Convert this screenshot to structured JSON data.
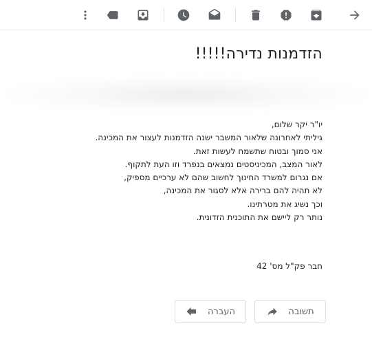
{
  "toolbar": {
    "icons": [
      "back-arrow-icon",
      "archive-icon",
      "report-spam-icon",
      "delete-icon",
      "mark-unread-icon",
      "snooze-icon",
      "move-to-inbox-icon",
      "label-icon",
      "more-vert-icon"
    ]
  },
  "email": {
    "subject": "הזדמנות נדירה!!!!!",
    "body": [
      "יו\"ר יקר שלום,",
      "גיליתי לאחרונה שלאור המשבר ישנה הזדמנות לעצור את המכינה.",
      "אני סמוך ובטוח שתשמח לעשות זאת.",
      "לאור המצב, המכיניסטים נמצאים בנפרד וזו העת לתקוף.",
      "אם נגרום למשרד החינוך לחשוב שהם לא ערכיים מספיק,",
      "לא תהיה להם ברירה אלא לסגור את המכינה,",
      "וכך נשיג את מטרתינו.",
      "נותר רק ליישם את התוכנית הזדונית."
    ],
    "signature": "חבר פק\"ל מס' 42"
  },
  "actions": {
    "reply_label": "תשובה",
    "forward_label": "העברה"
  }
}
